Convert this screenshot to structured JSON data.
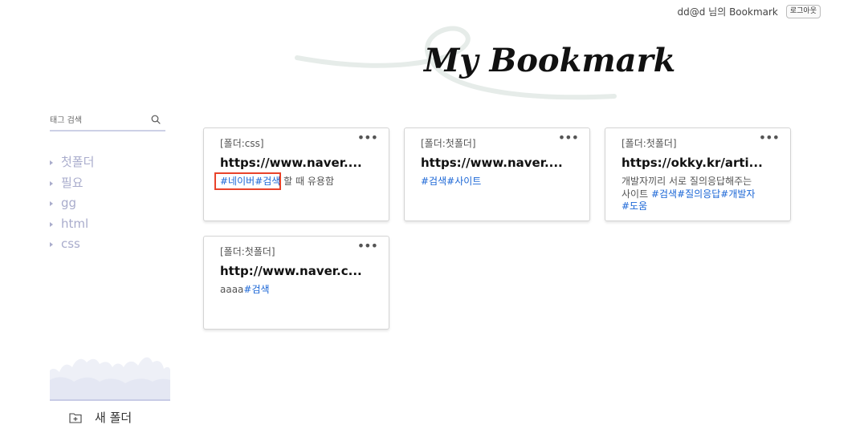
{
  "header": {
    "user_text": "dd@d 님의 Bookmark",
    "logout_label": "로그아웃",
    "page_title": "My Bookmark"
  },
  "sidebar": {
    "search_placeholder": "태그 검색",
    "folders": [
      {
        "label": "첫폴더"
      },
      {
        "label": "필요"
      },
      {
        "label": "gg"
      },
      {
        "label": "html"
      },
      {
        "label": "css"
      }
    ],
    "new_folder_label": "새 폴더"
  },
  "cards": [
    {
      "folder": "[폴더:css]",
      "menu": "•••",
      "url": "https://www.naver....",
      "tags_before": [
        "#네이버",
        "#검색"
      ],
      "text": "할 때 유용함",
      "tags_after": []
    },
    {
      "folder": "[폴더:첫폴더]",
      "menu": "•••",
      "url": "https://www.naver....",
      "tags_before": [
        "#검색",
        "#사이트"
      ],
      "text": "",
      "tags_after": []
    },
    {
      "folder": "[폴더:첫폴더]",
      "menu": "•••",
      "url": "https://okky.kr/arti...",
      "tags_before": [],
      "text": "개발자끼리 서로 질의응답해주는 사이트 ",
      "tags_after": [
        "#검색",
        "#질의응답",
        "#개발자",
        "#도움"
      ]
    },
    {
      "folder": "[폴더:첫폴더]",
      "menu": "•••",
      "url": "http://www.naver.c...",
      "tags_before": [],
      "text": "aaaa",
      "tags_after": [
        "#검색"
      ]
    }
  ],
  "colors": {
    "tag": "#1a66d6",
    "folder_text": "#a9accc",
    "highlight": "#e8432b"
  }
}
